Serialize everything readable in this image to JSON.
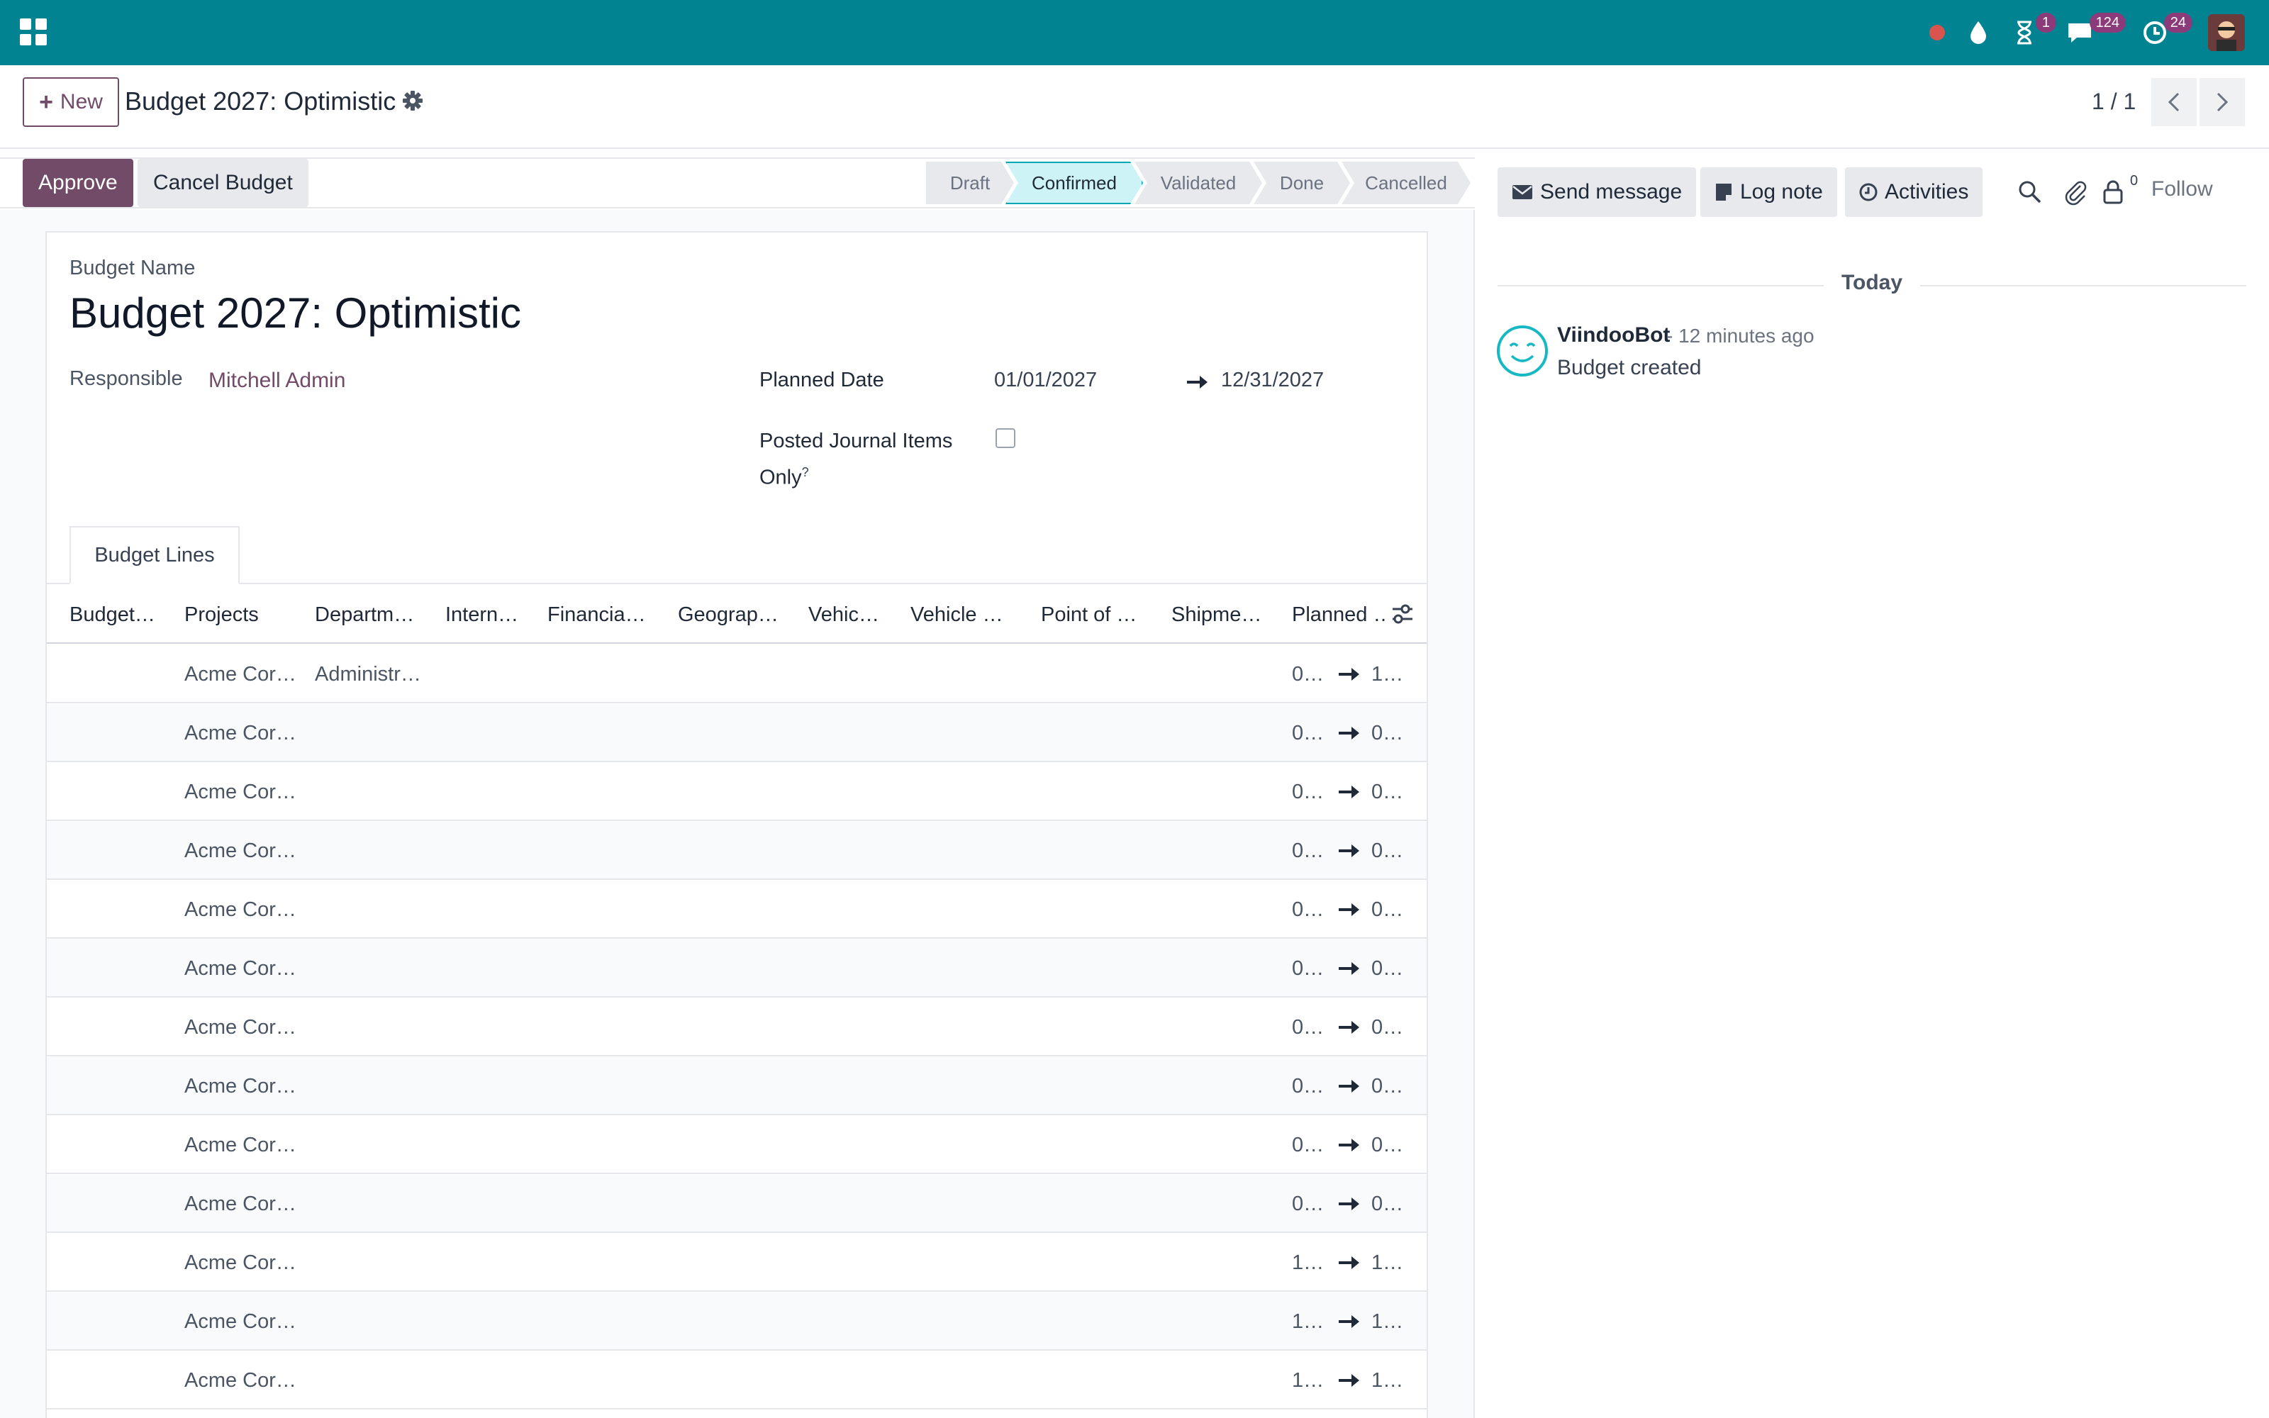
{
  "navbar": {
    "badges": {
      "activities": "1",
      "messages": "124",
      "calls": "24"
    }
  },
  "control_panel": {
    "new_label": "New",
    "title": "Budget 2027: Optimistic",
    "pager_value": "1 / 1"
  },
  "actions": {
    "approve": "Approve",
    "cancel_budget": "Cancel Budget"
  },
  "statusbar": {
    "steps": [
      {
        "label": "Draft",
        "active": false
      },
      {
        "label": "Confirmed",
        "active": true
      },
      {
        "label": "Validated",
        "active": false
      },
      {
        "label": "Done",
        "active": false
      },
      {
        "label": "Cancelled",
        "active": false
      }
    ]
  },
  "form": {
    "budget_name_label": "Budget Name",
    "budget_name": "Budget 2027: Optimistic",
    "responsible_label": "Responsible",
    "responsible": "Mitchell Admin",
    "planned_date_label": "Planned Date",
    "planned_date_start": "01/01/2027",
    "planned_date_end": "12/31/2027",
    "posted_label": "Posted Journal Items Only",
    "posted_tooltip": "?",
    "posted_checked": false
  },
  "tabs": {
    "budget_lines": "Budget Lines"
  },
  "table": {
    "headers": [
      "Budget…",
      "Projects",
      "Departm…",
      "Intern…",
      "Financia…",
      "Geograp…",
      "Vehic…",
      "Vehicle …",
      "Point of …",
      "Shipme…",
      "Planned …"
    ],
    "rows": [
      {
        "project": "Acme Cor…",
        "department": "Administr…",
        "date_start": "0…",
        "date_end": "1…"
      },
      {
        "project": "Acme Cor…",
        "department": "",
        "date_start": "0…",
        "date_end": "0…"
      },
      {
        "project": "Acme Cor…",
        "department": "",
        "date_start": "0…",
        "date_end": "0…"
      },
      {
        "project": "Acme Cor…",
        "department": "",
        "date_start": "0…",
        "date_end": "0…"
      },
      {
        "project": "Acme Cor…",
        "department": "",
        "date_start": "0…",
        "date_end": "0…"
      },
      {
        "project": "Acme Cor…",
        "department": "",
        "date_start": "0…",
        "date_end": "0…"
      },
      {
        "project": "Acme Cor…",
        "department": "",
        "date_start": "0…",
        "date_end": "0…"
      },
      {
        "project": "Acme Cor…",
        "department": "",
        "date_start": "0…",
        "date_end": "0…"
      },
      {
        "project": "Acme Cor…",
        "department": "",
        "date_start": "0…",
        "date_end": "0…"
      },
      {
        "project": "Acme Cor…",
        "department": "",
        "date_start": "0…",
        "date_end": "0…"
      },
      {
        "project": "Acme Cor…",
        "department": "",
        "date_start": "1…",
        "date_end": "1…"
      },
      {
        "project": "Acme Cor…",
        "department": "",
        "date_start": "1…",
        "date_end": "1…"
      },
      {
        "project": "Acme Cor…",
        "department": "",
        "date_start": "1…",
        "date_end": "1…"
      }
    ]
  },
  "chatter": {
    "send_message": "Send message",
    "log_note": "Log note",
    "activities": "Activities",
    "follower_count": "0",
    "follow": "Follow",
    "date_separator": "Today",
    "messages": [
      {
        "author": "ViindooBot",
        "time": "- 12 minutes ago",
        "body": "Budget created"
      }
    ]
  },
  "colors": {
    "navbar": "#018391",
    "brand": "#714b67",
    "status_active": "#cef3f6"
  }
}
